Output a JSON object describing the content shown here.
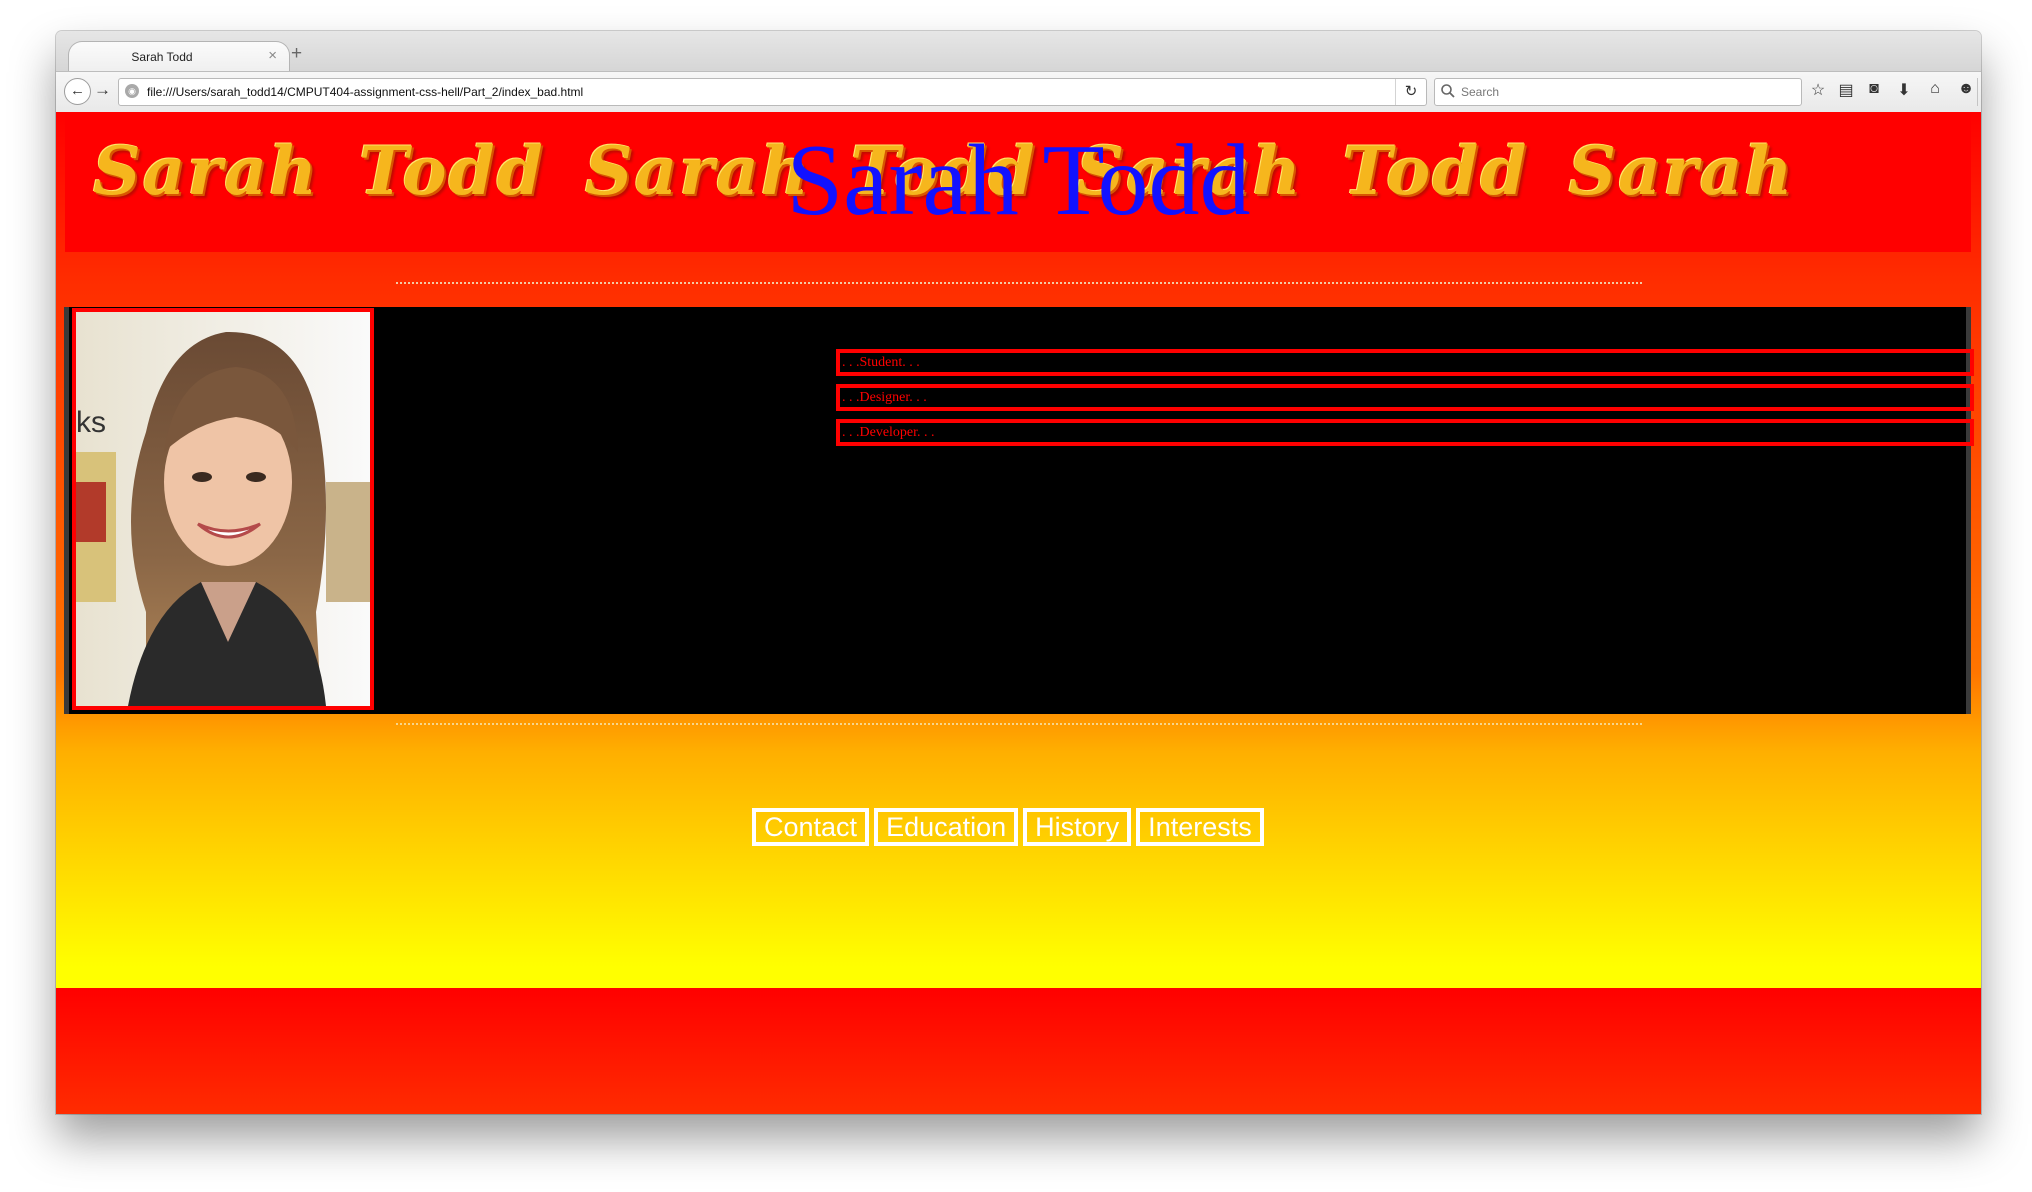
{
  "browser": {
    "tab_title": "Sarah Todd",
    "tab_close": "×",
    "new_tab": "+",
    "url": "file:///Users/sarah_todd14/CMPUT404-assignment-css-hell/Part_2/index_bad.html",
    "search_placeholder": "Search",
    "toolbar_icons": [
      "back-icon",
      "forward-icon",
      "reload-icon",
      "search-icon",
      "bookmark-star-icon",
      "reading-list-icon",
      "pocket-icon",
      "download-icon",
      "home-icon",
      "chat-icon",
      "menu-icon"
    ]
  },
  "page": {
    "banner_words": [
      "Sarah",
      "Todd",
      "Sarah",
      "Todd",
      "Sarah",
      "Todd",
      "Sarah"
    ],
    "site_title": "Sarah Todd",
    "roles": [
      ". . .Student. . .",
      ". . .Designer. . .",
      ". . .Developer. . ."
    ],
    "nav_links": [
      "Contact",
      "Education",
      "History",
      "Interests"
    ]
  },
  "colors": {
    "banner_bg": "#ff0000",
    "title": "#1212ff",
    "role_border": "#ff0000",
    "main_box": "#000000",
    "gradient_top": "#ff2d00",
    "gradient_bottom": "#ffff00",
    "nav_link_border": "#ffffff"
  }
}
